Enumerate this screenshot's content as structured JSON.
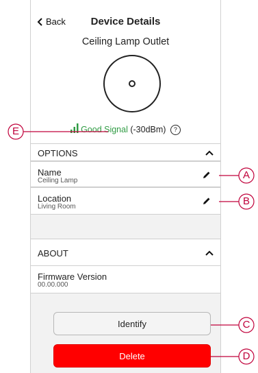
{
  "header": {
    "back_label": "Back",
    "title": "Device Details"
  },
  "device": {
    "name": "Ceiling Lamp Outlet"
  },
  "signal": {
    "status": "Good Signal",
    "strength": "(-30dBm)",
    "help_glyph": "?"
  },
  "options": {
    "header": "OPTIONS",
    "rows": [
      {
        "label": "Name",
        "value": "Ceiling Lamp"
      },
      {
        "label": "Location",
        "value": "Living Room"
      }
    ]
  },
  "about": {
    "header": "ABOUT",
    "firmware_label": "Firmware Version",
    "firmware_value": "00.00.000"
  },
  "buttons": {
    "identify": "Identify",
    "delete": "Delete"
  },
  "callouts": {
    "a": "A",
    "b": "B",
    "c": "C",
    "d": "D",
    "e": "E"
  },
  "colors": {
    "signal_green": "#2f9b43",
    "delete_red": "#ff0000",
    "callout": "#c0003a"
  }
}
